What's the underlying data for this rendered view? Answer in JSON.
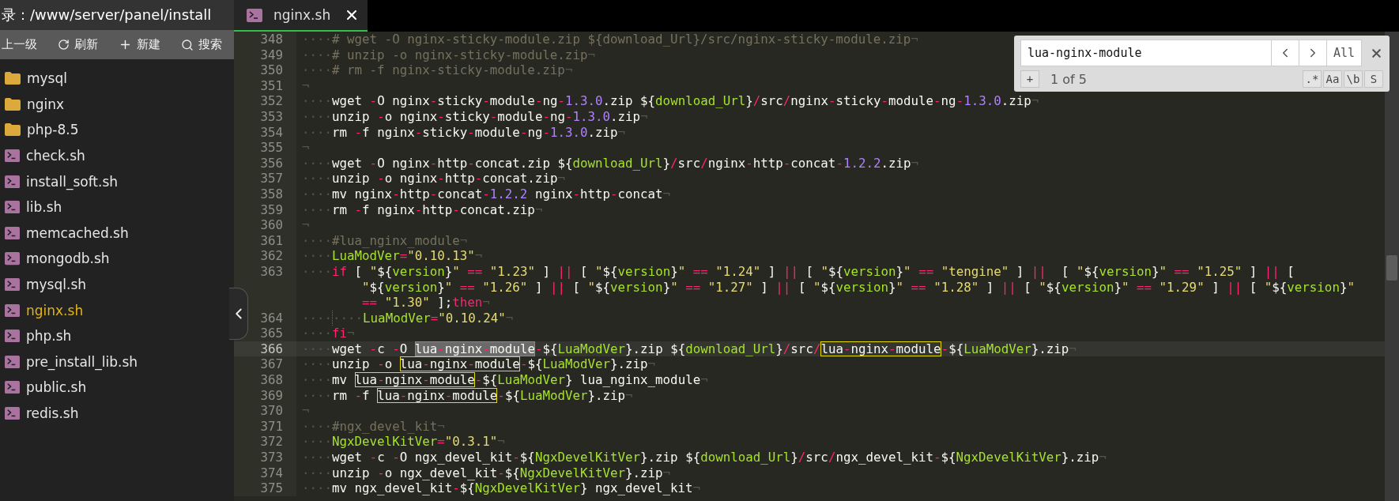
{
  "sidebar": {
    "path": "录：/www/server/panel/install",
    "toolbar": [
      {
        "label": "上一级",
        "kind": "up"
      },
      {
        "label": "刷新",
        "kind": "refresh"
      },
      {
        "label": "新建",
        "kind": "new"
      },
      {
        "label": "搜索",
        "kind": "search"
      }
    ],
    "files": [
      {
        "name": "mysql",
        "kind": "folder",
        "selected": false
      },
      {
        "name": "nginx",
        "kind": "folder",
        "selected": false
      },
      {
        "name": "php-8.5",
        "kind": "folder",
        "selected": false
      },
      {
        "name": "check.sh",
        "kind": "script",
        "selected": false
      },
      {
        "name": "install_soft.sh",
        "kind": "script",
        "selected": false
      },
      {
        "name": "lib.sh",
        "kind": "script",
        "selected": false
      },
      {
        "name": "memcached.sh",
        "kind": "script",
        "selected": false
      },
      {
        "name": "mongodb.sh",
        "kind": "script",
        "selected": false
      },
      {
        "name": "mysql.sh",
        "kind": "script",
        "selected": false
      },
      {
        "name": "nginx.sh",
        "kind": "script",
        "selected": true
      },
      {
        "name": "php.sh",
        "kind": "script",
        "selected": false
      },
      {
        "name": "pre_install_lib.sh",
        "kind": "script",
        "selected": false
      },
      {
        "name": "public.sh",
        "kind": "script",
        "selected": false
      },
      {
        "name": "redis.sh",
        "kind": "script",
        "selected": false
      }
    ]
  },
  "tabs": [
    {
      "label": "nginx.sh",
      "selected": true
    }
  ],
  "editor": {
    "lines": [
      {
        "number": "348",
        "active": false,
        "segs": [
          {
            "text": "····",
            "kind": "ws"
          },
          {
            "text": "# wget -O nginx-sticky-module.zip ${download_Url}/src/nginx-sticky-module.zip",
            "kind": "cmt"
          },
          {
            "text": "¬",
            "kind": "ws"
          }
        ]
      },
      {
        "number": "349",
        "active": false,
        "segs": [
          {
            "text": "····",
            "kind": "ws"
          },
          {
            "text": "# unzip -o nginx-sticky-module.zip",
            "kind": "cmt"
          },
          {
            "text": "¬",
            "kind": "ws"
          }
        ]
      },
      {
        "number": "350",
        "active": false,
        "segs": [
          {
            "text": "····",
            "kind": "ws"
          },
          {
            "text": "# rm -f nginx-sticky-module.zip",
            "kind": "cmt"
          },
          {
            "text": "¬",
            "kind": "ws"
          }
        ]
      },
      {
        "number": "351",
        "active": false,
        "segs": [
          {
            "text": "¬",
            "kind": "ws"
          }
        ]
      },
      {
        "number": "352",
        "active": false,
        "segs": [
          {
            "text": "····",
            "kind": "ws"
          },
          {
            "text": "wget -O nginx-sticky-module-ng-1.3.0.zip ${download_Url}/src/nginx-sticky-module-ng-1.3.0.zip",
            "kind": "code"
          },
          {
            "text": "¬",
            "kind": "ws"
          }
        ]
      },
      {
        "number": "353",
        "active": false,
        "segs": [
          {
            "text": "····",
            "kind": "ws"
          },
          {
            "text": "unzip -o nginx-sticky-module-ng-1.3.0.zip",
            "kind": "code"
          },
          {
            "text": "¬",
            "kind": "ws"
          }
        ]
      },
      {
        "number": "354",
        "active": false,
        "segs": [
          {
            "text": "····",
            "kind": "ws"
          },
          {
            "text": "rm -f nginx-sticky-module-ng-1.3.0.zip",
            "kind": "code"
          },
          {
            "text": "¬",
            "kind": "ws"
          }
        ]
      },
      {
        "number": "355",
        "active": false,
        "segs": [
          {
            "text": "¬",
            "kind": "ws"
          }
        ]
      },
      {
        "number": "356",
        "active": false,
        "segs": [
          {
            "text": "····",
            "kind": "ws"
          },
          {
            "text": "wget -O nginx-http-concat.zip ${download_Url}/src/nginx-http-concat-1.2.2.zip",
            "kind": "code"
          },
          {
            "text": "¬",
            "kind": "ws"
          }
        ]
      },
      {
        "number": "357",
        "active": false,
        "segs": [
          {
            "text": "····",
            "kind": "ws"
          },
          {
            "text": "unzip -o nginx-http-concat.zip",
            "kind": "code"
          },
          {
            "text": "¬",
            "kind": "ws"
          }
        ]
      },
      {
        "number": "358",
        "active": false,
        "segs": [
          {
            "text": "····",
            "kind": "ws"
          },
          {
            "text": "mv nginx-http-concat-1.2.2 nginx-http-concat",
            "kind": "code"
          },
          {
            "text": "¬",
            "kind": "ws"
          }
        ]
      },
      {
        "number": "359",
        "active": false,
        "segs": [
          {
            "text": "····",
            "kind": "ws"
          },
          {
            "text": "rm -f nginx-http-concat.zip",
            "kind": "code"
          },
          {
            "text": "¬",
            "kind": "ws"
          }
        ]
      },
      {
        "number": "360",
        "active": false,
        "segs": [
          {
            "text": "¬",
            "kind": "ws"
          }
        ]
      },
      {
        "number": "361",
        "active": false,
        "segs": [
          {
            "text": "····",
            "kind": "ws"
          },
          {
            "text": "#lua_nginx_module",
            "kind": "cmt"
          },
          {
            "text": "¬",
            "kind": "ws"
          }
        ]
      },
      {
        "number": "362",
        "active": false,
        "segs": [
          {
            "text": "····",
            "kind": "ws"
          },
          {
            "text": "LuaModVer",
            "kind": "var"
          },
          {
            "text": "=\"0.10.13\"",
            "kind": "code"
          },
          {
            "text": "¬",
            "kind": "ws"
          }
        ]
      },
      {
        "number": "363",
        "active": false,
        "segs": [
          {
            "text": "····",
            "kind": "ws"
          },
          {
            "text": "if",
            "kind": "kw"
          },
          {
            "text": " [ \"${version}\" == \"1.23\" ] || [ \"${version}\" == \"1.24\" ] || [ \"${version}\" == \"tengine\" ] ||  [ \"${version}\" == \"1.25\" ] || [ \"${version}\" == \"1.26\" ] || [ \"${version}\" == \"1.27\" ] || [ \"${version}\" == \"1.28\" ] || [ \"${version}\" == \"1.29\" ] || [ \"${version}\" == \"1.30\" ];",
            "kind": "code"
          },
          {
            "text": "then",
            "kind": "kw"
          },
          {
            "text": "¬",
            "kind": "ws"
          }
        ]
      },
      {
        "number": "364",
        "active": false,
        "segs": [
          {
            "text": "····",
            "kind": "ws"
          },
          {
            "text": "····",
            "kind": "indent"
          },
          {
            "text": "LuaModVer",
            "kind": "var"
          },
          {
            "text": "=\"0.10.24\"",
            "kind": "code"
          },
          {
            "text": "¬",
            "kind": "ws"
          }
        ]
      },
      {
        "number": "365",
        "active": false,
        "segs": [
          {
            "text": "····",
            "kind": "ws"
          },
          {
            "text": "fi",
            "kind": "kw"
          },
          {
            "text": "¬",
            "kind": "ws"
          }
        ]
      },
      {
        "number": "366",
        "active": true,
        "segs": [
          {
            "text": "····",
            "kind": "ws"
          },
          {
            "text": "wget -c -O ",
            "kind": "code"
          },
          {
            "text": "lua-nginx-module",
            "kind": "current"
          },
          {
            "text": "-${LuaModVer}.zip ${download_Url}/src/",
            "kind": "code"
          },
          {
            "text": "lua-nginx-module",
            "kind": "match"
          },
          {
            "text": "-${LuaModVer}.zip",
            "kind": "code"
          },
          {
            "text": "¬",
            "kind": "ws"
          }
        ]
      },
      {
        "number": "367",
        "active": false,
        "segs": [
          {
            "text": "····",
            "kind": "ws"
          },
          {
            "text": "unzip -o ",
            "kind": "code"
          },
          {
            "text": "lua-nginx-module",
            "kind": "match"
          },
          {
            "text": "-${LuaModVer}.zip",
            "kind": "code"
          },
          {
            "text": "¬",
            "kind": "ws"
          }
        ]
      },
      {
        "number": "368",
        "active": false,
        "segs": [
          {
            "text": "····",
            "kind": "ws"
          },
          {
            "text": "mv ",
            "kind": "code"
          },
          {
            "text": "lua-nginx-module",
            "kind": "match"
          },
          {
            "text": "-${LuaModVer} lua_nginx_module",
            "kind": "code"
          },
          {
            "text": "¬",
            "kind": "ws"
          }
        ]
      },
      {
        "number": "369",
        "active": false,
        "segs": [
          {
            "text": "····",
            "kind": "ws"
          },
          {
            "text": "rm -f ",
            "kind": "code"
          },
          {
            "text": "lua-nginx-module",
            "kind": "match"
          },
          {
            "text": "-${LuaModVer}.zip",
            "kind": "code"
          },
          {
            "text": "¬",
            "kind": "ws"
          }
        ]
      },
      {
        "number": "370",
        "active": false,
        "segs": [
          {
            "text": "¬",
            "kind": "ws"
          }
        ]
      },
      {
        "number": "371",
        "active": false,
        "segs": [
          {
            "text": "····",
            "kind": "ws"
          },
          {
            "text": "#ngx_devel_kit",
            "kind": "cmt"
          },
          {
            "text": "¬",
            "kind": "ws"
          }
        ]
      },
      {
        "number": "372",
        "active": false,
        "segs": [
          {
            "text": "····",
            "kind": "ws"
          },
          {
            "text": "NgxDevelKitVer",
            "kind": "var"
          },
          {
            "text": "=\"0.3.1\"",
            "kind": "code"
          },
          {
            "text": "¬",
            "kind": "ws"
          }
        ]
      },
      {
        "number": "373",
        "active": false,
        "segs": [
          {
            "text": "····",
            "kind": "ws"
          },
          {
            "text": "wget -c -O ngx_devel_kit-${NgxDevelKitVer}.zip ${download_Url}/src/ngx_devel_kit-${NgxDevelKitVer}.zip",
            "kind": "code"
          },
          {
            "text": "¬",
            "kind": "ws"
          }
        ]
      },
      {
        "number": "374",
        "active": false,
        "segs": [
          {
            "text": "····",
            "kind": "ws"
          },
          {
            "text": "unzip -o ngx_devel_kit-${NgxDevelKitVer}.zip",
            "kind": "code"
          },
          {
            "text": "¬",
            "kind": "ws"
          }
        ]
      },
      {
        "number": "375",
        "active": false,
        "segs": [
          {
            "text": "····",
            "kind": "ws"
          },
          {
            "text": "mv ngx_devel_kit-${NgxDevelKitVer} ngx_devel_kit",
            "kind": "code"
          },
          {
            "text": "¬",
            "kind": "ws"
          }
        ]
      }
    ]
  },
  "search": {
    "value": "lua-nginx-module",
    "all": "All",
    "add": "+",
    "count": "1 of 5",
    "options": [
      {
        "label": ".*",
        "on": false
      },
      {
        "label": "Aa",
        "on": false
      },
      {
        "label": "\\b",
        "on": false
      },
      {
        "label": "S",
        "on": false
      }
    ]
  }
}
